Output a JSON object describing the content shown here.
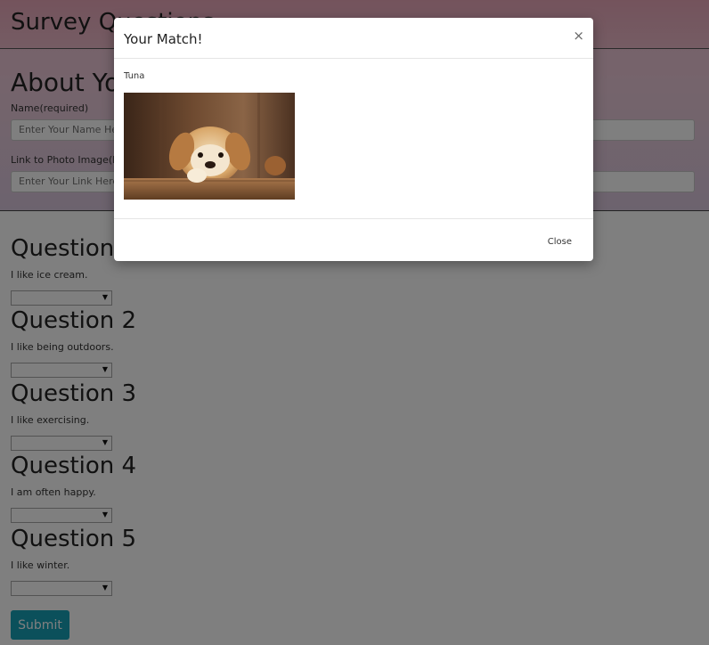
{
  "page": {
    "title": "Survey Questions",
    "about_title": "About You"
  },
  "form": {
    "name_label": "Name(required)",
    "name_placeholder": "Enter Your Name Here",
    "photo_label": "Link to Photo Image(Required)",
    "photo_placeholder": "Enter Your Link Here"
  },
  "questions": [
    {
      "title": "Question 1",
      "text": "I like ice cream."
    },
    {
      "title": "Question 2",
      "text": "I like being outdoors."
    },
    {
      "title": "Question 3",
      "text": "I like exercising."
    },
    {
      "title": "Question 4",
      "text": "I am often happy."
    },
    {
      "title": "Question 5",
      "text": "I like winter."
    }
  ],
  "submit_label": "Submit",
  "modal": {
    "title": "Your Match!",
    "close_x": "×",
    "match_name": "Tuna",
    "close_label": "Close"
  },
  "colors": {
    "accent": "#16a0b6",
    "header_gradient_top": "#e9a7b9",
    "overlay": "rgba(0,0,0,0.5)"
  },
  "icons": {
    "modal_close": "close-icon",
    "select_arrow": "chevron-down-icon"
  }
}
